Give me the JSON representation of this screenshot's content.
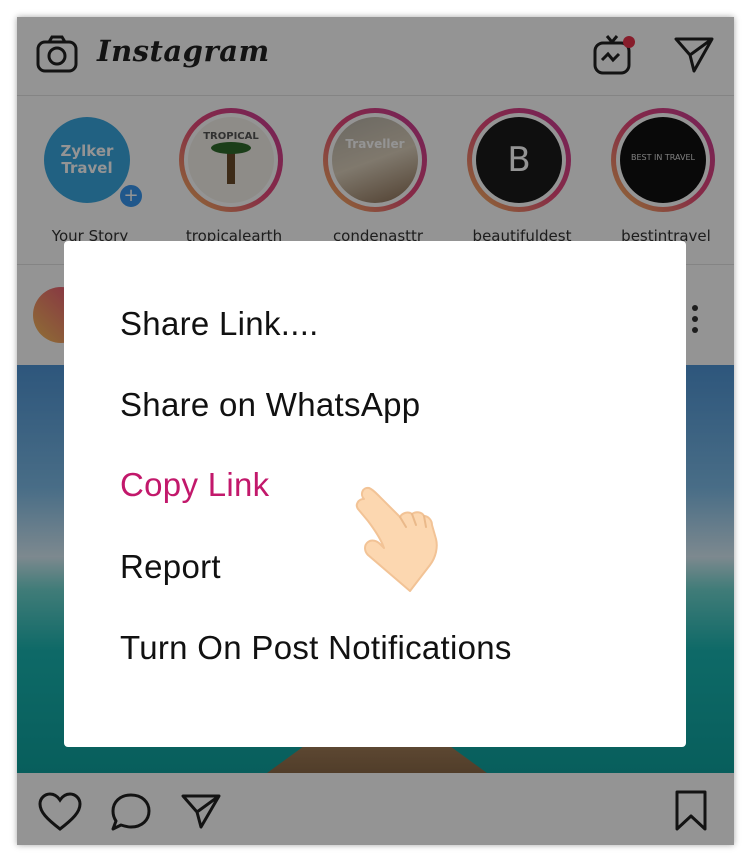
{
  "app": {
    "title": "Instagram"
  },
  "header": {
    "camera_icon": "camera-icon",
    "igtv_icon": "igtv-icon",
    "direct_icon": "paper-plane-icon"
  },
  "stories": [
    {
      "label": "Your Story",
      "pic_text": "Zylker Travel"
    },
    {
      "label": "tropicalearth",
      "pic_text": "TROPICAL"
    },
    {
      "label": "condenasttr",
      "pic_text": "Traveller"
    },
    {
      "label": "beautifuldest",
      "pic_text": "B"
    },
    {
      "label": "bestintravel",
      "pic_text": "BEST IN TRAVEL"
    }
  ],
  "menu": {
    "items": [
      {
        "label": "Share Link...."
      },
      {
        "label": "Share on WhatsApp"
      },
      {
        "label": "Copy Link"
      },
      {
        "label": "Report"
      },
      {
        "label": "Turn On Post Notifications"
      }
    ],
    "highlight_color": "#c2186b"
  },
  "actions": {
    "like_icon": "heart-icon",
    "comment_icon": "comment-icon",
    "share_icon": "paper-plane-icon",
    "save_icon": "bookmark-icon"
  }
}
